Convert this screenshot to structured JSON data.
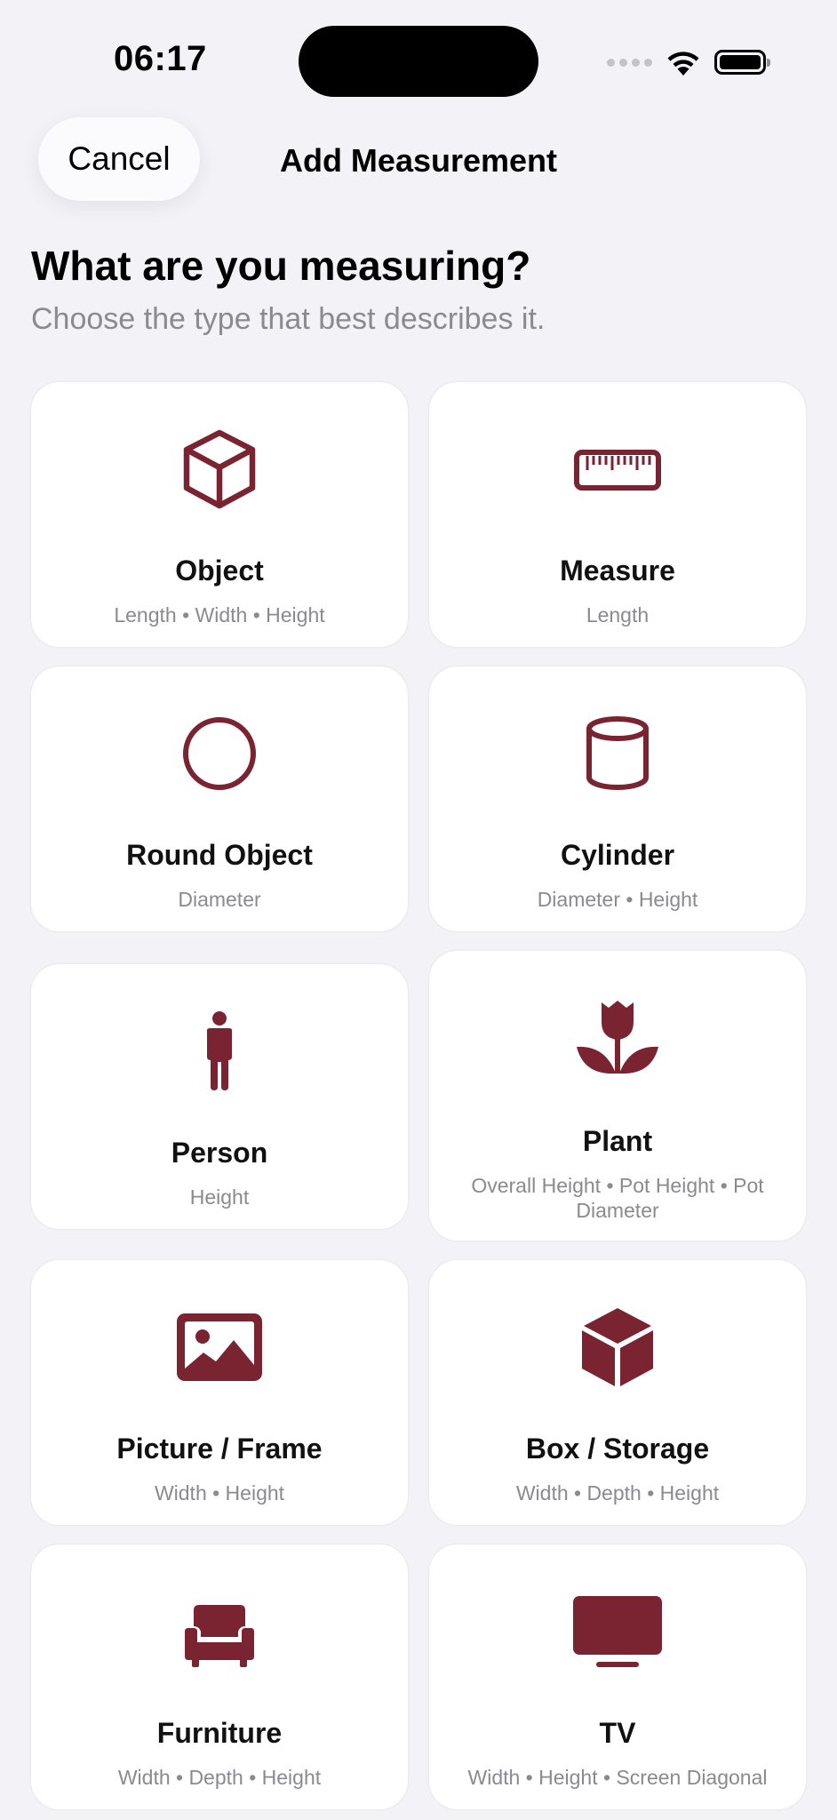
{
  "status_bar": {
    "time": "06:17"
  },
  "nav": {
    "cancel_label": "Cancel",
    "title": "Add Measurement"
  },
  "heading": "What are you measuring?",
  "subheading": "Choose the type that best describes it.",
  "accent_color": "#7a2432",
  "cards": [
    {
      "title": "Object",
      "subtitle": "Length • Width • Height",
      "icon": "cube-outline-icon"
    },
    {
      "title": "Measure",
      "subtitle": "Length",
      "icon": "ruler-icon"
    },
    {
      "title": "Round Object",
      "subtitle": "Diameter",
      "icon": "circle-icon"
    },
    {
      "title": "Cylinder",
      "subtitle": "Diameter • Height",
      "icon": "cylinder-icon"
    },
    {
      "title": "Person",
      "subtitle": "Height",
      "icon": "person-icon"
    },
    {
      "title": "Plant",
      "subtitle": "Overall Height • Pot Height • Pot Diameter",
      "icon": "tulip-icon"
    },
    {
      "title": "Picture / Frame",
      "subtitle": "Width • Height",
      "icon": "photo-icon"
    },
    {
      "title": "Box / Storage",
      "subtitle": "Width • Depth • Height",
      "icon": "cube-filled-icon"
    },
    {
      "title": "Furniture",
      "subtitle": "Width • Depth • Height",
      "icon": "armchair-icon"
    },
    {
      "title": "TV",
      "subtitle": "Width • Height • Screen Diagonal",
      "icon": "tv-icon"
    }
  ]
}
